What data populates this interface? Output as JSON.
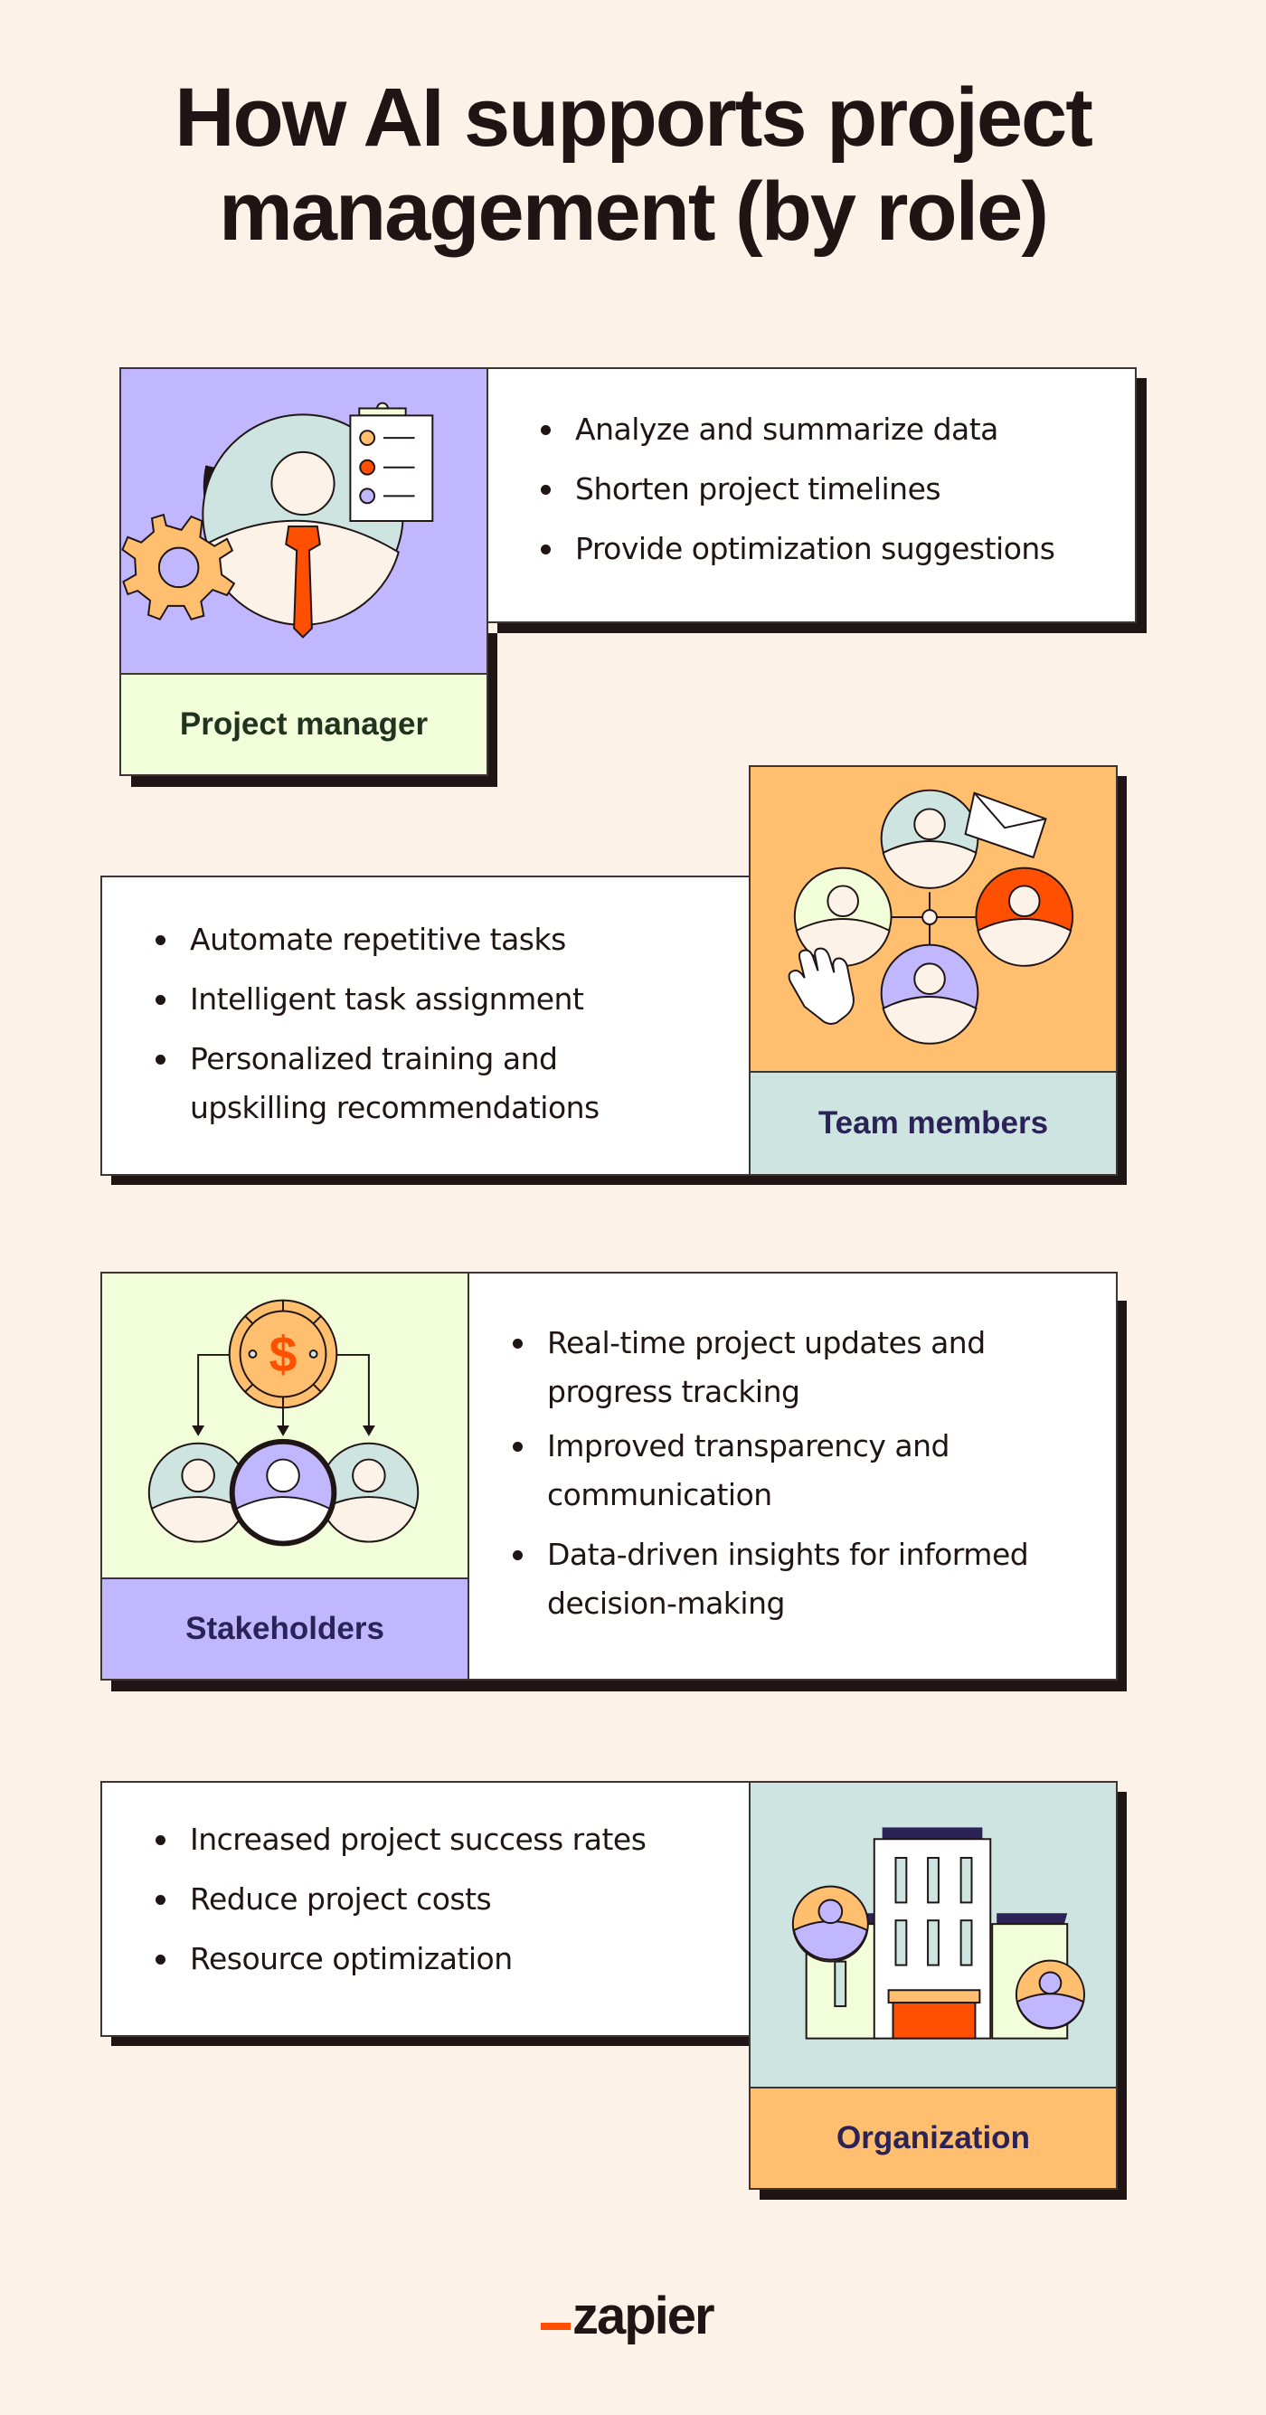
{
  "title": {
    "line1": "How AI supports project",
    "line2": "management (by role)"
  },
  "colors": {
    "background": "#fdf2e7",
    "dark": "#201515",
    "lavender": "#c1b7ff",
    "mint": "#cde4e1",
    "pale_green": "#f1fed9",
    "peach": "#ffbf6e",
    "orange": "#ff4f00",
    "navy": "#2b2358"
  },
  "cards": [
    {
      "role": "Project manager",
      "illustration": "manager-with-gear-and-clipboard-icon",
      "bullets": [
        "Analyze and summarize data",
        "Shorten project timelines",
        "Provide optimization suggestions"
      ]
    },
    {
      "role": "Team members",
      "illustration": "connected-team-network-icon",
      "bullets": [
        "Automate repetitive tasks",
        "Intelligent task assignment",
        "Personalized training and upskilling recommendations"
      ]
    },
    {
      "role": "Stakeholders",
      "illustration": "coin-distribution-to-people-icon",
      "bullets": [
        "Real-time project updates and progress tracking",
        "Improved transparency and communication",
        "Data-driven insights for informed decision-making"
      ]
    },
    {
      "role": "Organization",
      "illustration": "office-building-with-people-icon",
      "bullets": [
        "Increased project success rates",
        "Reduce project costs",
        "Resource optimization"
      ]
    }
  ],
  "footer": {
    "logo_text": "zapier"
  }
}
